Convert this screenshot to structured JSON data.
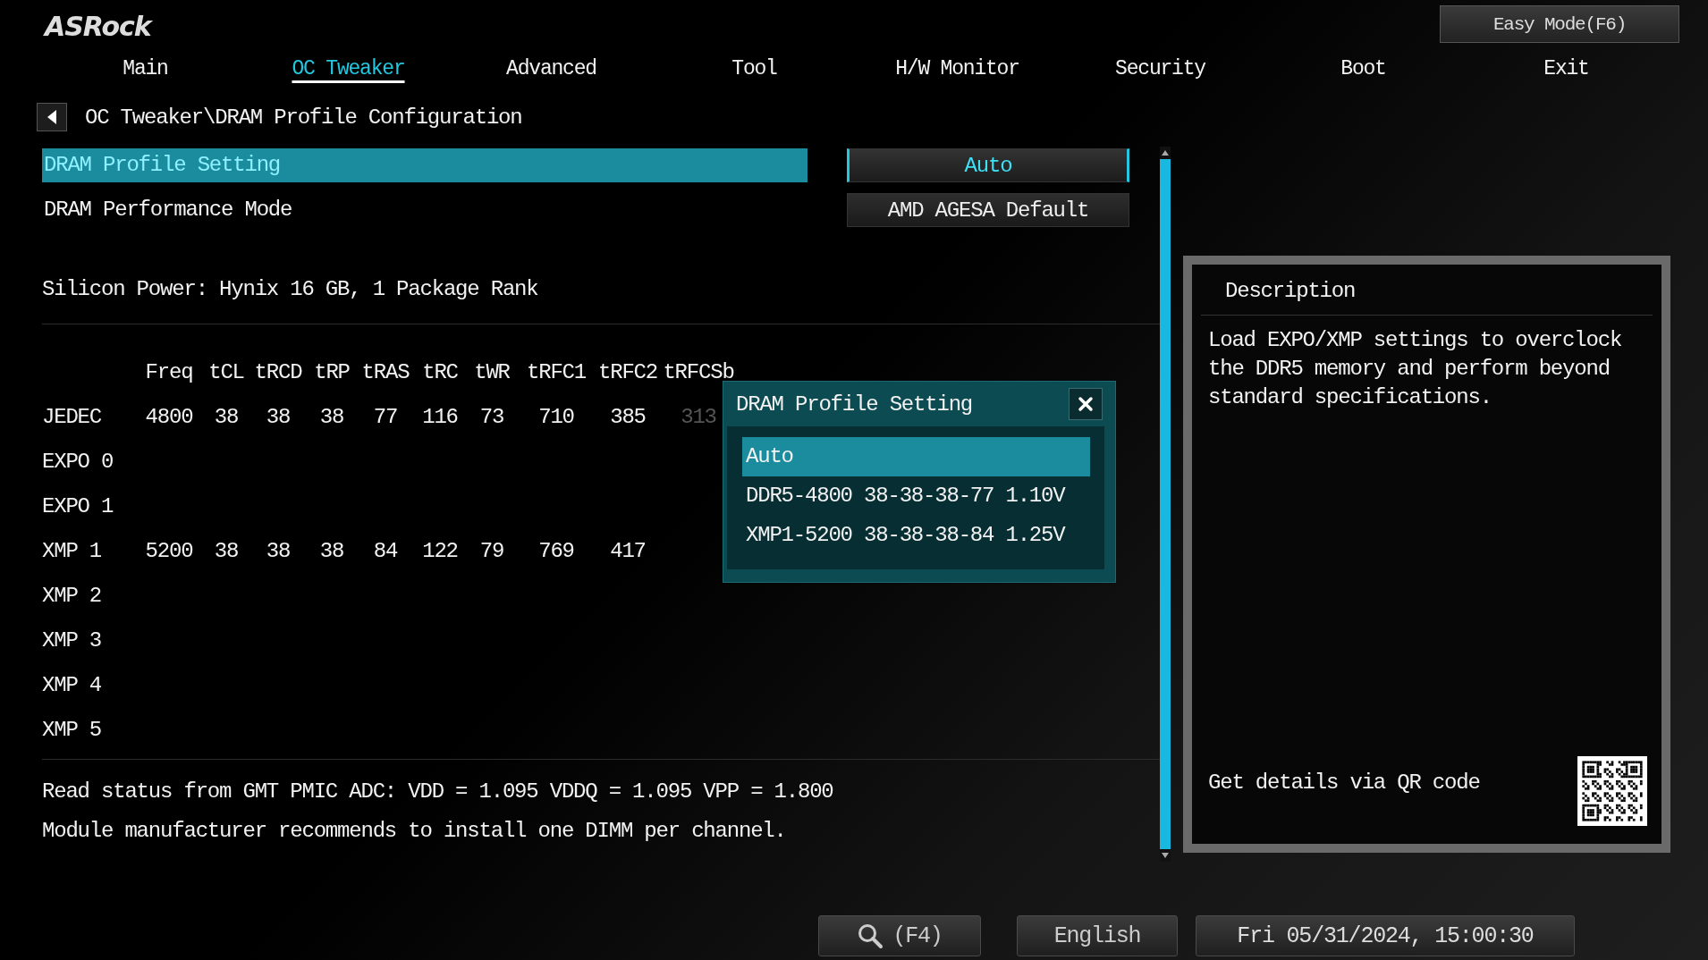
{
  "logo": "ASRock",
  "easy_mode": "Easy Mode(F6)",
  "tabs": [
    {
      "label": "Main",
      "selected": false
    },
    {
      "label": "OC Tweaker",
      "selected": true
    },
    {
      "label": "Advanced",
      "selected": false
    },
    {
      "label": "Tool",
      "selected": false
    },
    {
      "label": "H/W Monitor",
      "selected": false
    },
    {
      "label": "Security",
      "selected": false
    },
    {
      "label": "Boot",
      "selected": false
    },
    {
      "label": "Exit",
      "selected": false
    }
  ],
  "breadcrumb": "OC Tweaker\\DRAM Profile Configuration",
  "settings": [
    {
      "label": "DRAM Profile Setting",
      "value": "Auto",
      "selected": true
    },
    {
      "label": "DRAM Performance Mode",
      "value": "AMD AGESA Default",
      "selected": false
    }
  ],
  "module_info": "Silicon Power: Hynix 16 GB, 1 Package Rank",
  "table": {
    "columns": [
      "Freq",
      "tCL",
      "tRCD",
      "tRP",
      "tRAS",
      "tRC",
      "tWR",
      "tRFC1",
      "tRFC2",
      "tRFCSb"
    ],
    "rows": [
      {
        "name": "JEDEC",
        "cells": [
          "4800",
          "38",
          "38",
          "38",
          "77",
          "116",
          "73",
          "710",
          "385",
          "313"
        ]
      },
      {
        "name": "EXPO 0",
        "cells": []
      },
      {
        "name": "EXPO 1",
        "cells": []
      },
      {
        "name": "XMP 1",
        "cells": [
          "5200",
          "38",
          "38",
          "38",
          "84",
          "122",
          "79",
          "769",
          "417"
        ]
      },
      {
        "name": "XMP 2",
        "cells": []
      },
      {
        "name": "XMP 3",
        "cells": []
      },
      {
        "name": "XMP 4",
        "cells": []
      },
      {
        "name": "XMP 5",
        "cells": []
      }
    ]
  },
  "status_lines": [
    "Read status from GMT PMIC ADC: VDD = 1.095 VDDQ = 1.095 VPP = 1.800",
    "Module manufacturer recommends to install one DIMM per channel."
  ],
  "popup": {
    "title": "DRAM Profile Setting",
    "options": [
      {
        "label": "Auto",
        "selected": true
      },
      {
        "label": "DDR5-4800 38-38-38-77 1.10V",
        "selected": false
      },
      {
        "label": "XMP1-5200 38-38-38-84 1.25V",
        "selected": false
      }
    ]
  },
  "description": {
    "title": "Description",
    "text": "Load EXPO/XMP settings to overclock the DDR5 memory and perform beyond standard specifications.",
    "qr_label": "Get details via QR code"
  },
  "footer": {
    "search": "(F4)",
    "language": "English",
    "datetime": "Fri 05/31/2024, 15:00:30"
  }
}
